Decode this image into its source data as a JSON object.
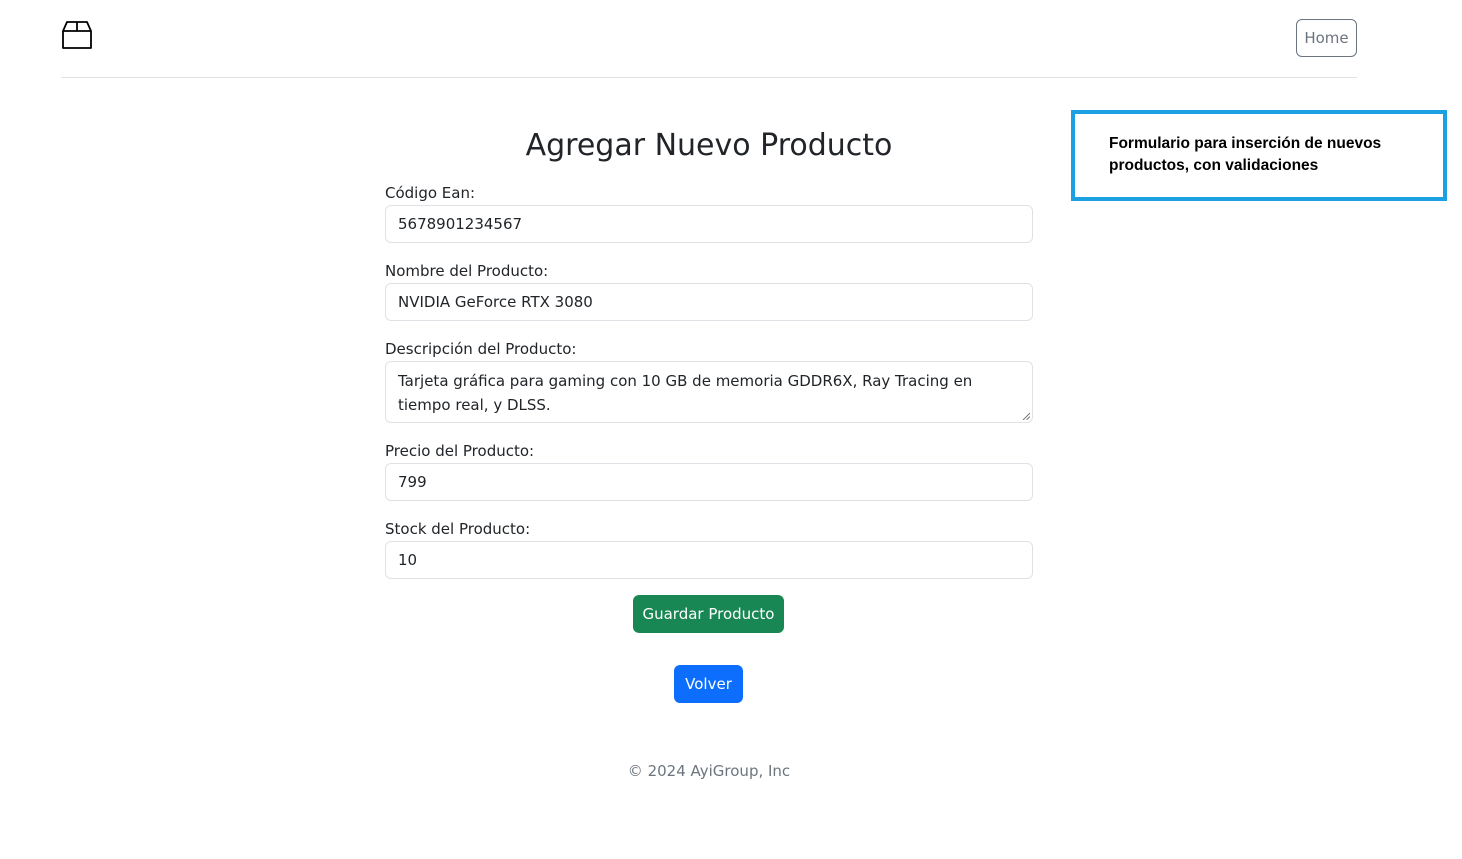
{
  "header": {
    "logo_icon": "box-icon",
    "home_label": "Home"
  },
  "annotation": {
    "text": "Formulario para inserción de nuevos productos, con validaciones"
  },
  "form": {
    "title": "Agregar Nuevo Producto",
    "ean": {
      "label": "Código Ean:",
      "value": "5678901234567"
    },
    "name": {
      "label": "Nombre del Producto:",
      "value": "NVIDIA GeForce RTX 3080"
    },
    "description": {
      "label": "Descripción del Producto:",
      "value": "Tarjeta gráfica para gaming con 10 GB de memoria GDDR6X, Ray Tracing en tiempo real, y DLSS."
    },
    "price": {
      "label": "Precio del Producto:",
      "value": "799"
    },
    "stock": {
      "label": "Stock del Producto:",
      "value": "10"
    },
    "save_label": "Guardar Producto",
    "back_label": "Volver"
  },
  "footer": {
    "copyright": "© 2024 AyiGroup, Inc"
  },
  "colors": {
    "save_button": "#198754",
    "back_button": "#0d6efd",
    "annotation_border": "#1ba1e2"
  }
}
